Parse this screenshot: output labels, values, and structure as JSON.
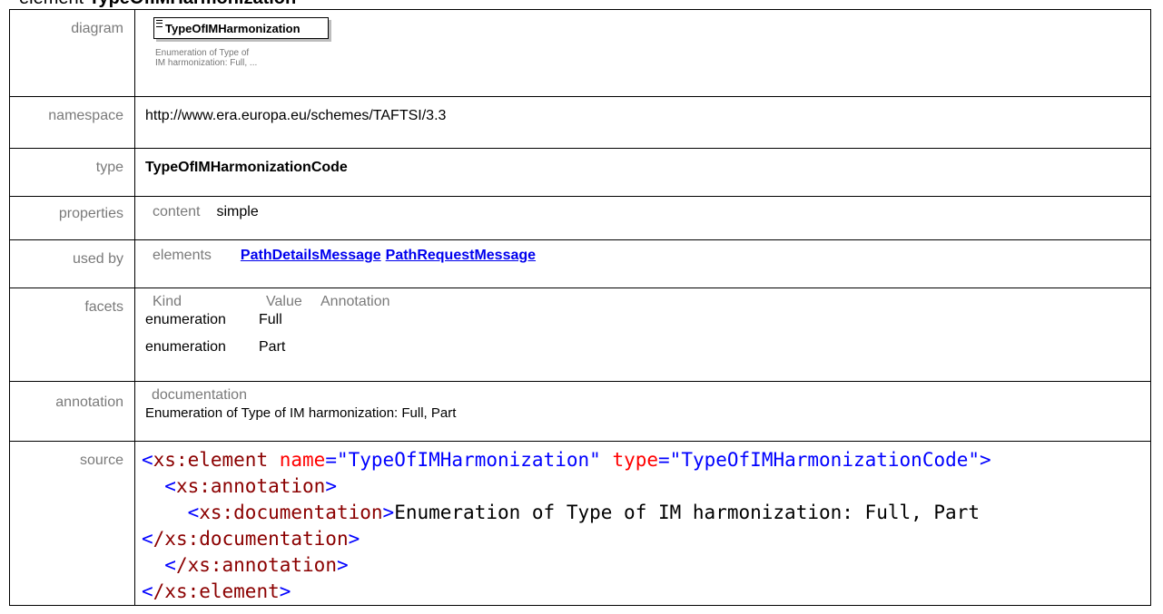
{
  "heading": {
    "prefix": "element ",
    "name": "TypeOfIMHarmonization"
  },
  "labels": {
    "diagram": "diagram",
    "namespace": "namespace",
    "type": "type",
    "properties": "properties",
    "used_by": "used by",
    "facets": "facets",
    "annotation": "annotation",
    "source": "source"
  },
  "diagram": {
    "element_name": "TypeOfIMHarmonization",
    "caption_line1": "Enumeration of Type of",
    "caption_line2": "IM harmonization: Full, ..."
  },
  "namespace": "http://www.era.europa.eu/schemes/TAFTSI/3.3",
  "type": "TypeOfIMHarmonizationCode",
  "properties": {
    "label": "content",
    "value": "simple"
  },
  "used_by": {
    "label": "elements",
    "links": [
      "PathDetailsMessage",
      "PathRequestMessage"
    ]
  },
  "facets": {
    "headers": [
      "Kind",
      "Value",
      "Annotation"
    ],
    "rows": [
      {
        "kind": "enumeration",
        "value": "Full"
      },
      {
        "kind": "enumeration",
        "value": "Part"
      }
    ]
  },
  "annotation": {
    "label": "documentation",
    "text": "Enumeration of Type of IM harmonization: Full, Part"
  },
  "source": {
    "open_tag": "xs:element",
    "attr_name": "name",
    "attr_name_value": "\"TypeOfIMHarmonization\"",
    "attr_type": "type",
    "attr_type_value": "\"TypeOfIMHarmonizationCode\"",
    "annotation_tag": "xs:annotation",
    "documentation_tag": "xs:documentation",
    "documentation_text": "Enumeration of Type of IM harmonization: Full, Part",
    "close_documentation": "/xs:documentation",
    "close_annotation": "/xs:annotation",
    "close_element": "/xs:element"
  },
  "colors": {
    "label_gray": "#7a7a7a",
    "link_blue": "#0000ee",
    "xml_bracket": "#0000ff",
    "xml_tagname": "#8b0000",
    "xml_attr": "#ff0000"
  }
}
